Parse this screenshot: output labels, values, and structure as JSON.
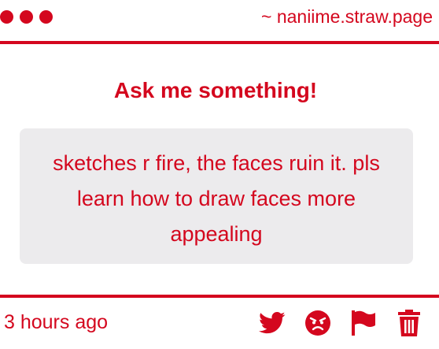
{
  "window": {
    "dots": [
      "red",
      "red",
      "red"
    ],
    "url": "~ naniime.straw.page"
  },
  "card": {
    "title": "Ask me something!",
    "message": "sketches r fire, the faces ruin it. pls learn how to draw faces more appealing"
  },
  "footer": {
    "timestamp": "3 hours ago",
    "actions": [
      {
        "icon": "twitter-icon"
      },
      {
        "icon": "angry-face-icon"
      },
      {
        "icon": "flag-icon"
      },
      {
        "icon": "trash-icon"
      }
    ]
  },
  "colors": {
    "accent": "#d4071e",
    "message_bg": "#ecebed",
    "background": "#ffffff"
  }
}
